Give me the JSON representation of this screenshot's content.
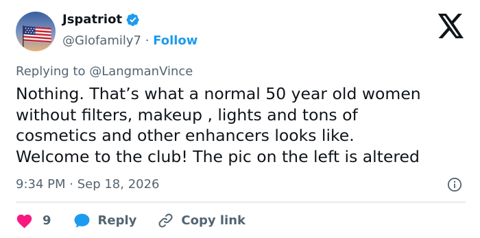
{
  "author": {
    "display_name": "Jspatriot",
    "handle": "@Glofamily7",
    "separator": " · ",
    "follow_label": "Follow",
    "verified": true,
    "avatar_icon": "us-flag-avatar"
  },
  "platform_logo": "x-logo-icon",
  "reply_context": {
    "prefix": "Replying to ",
    "handle": "@LangmanVince"
  },
  "tweet": {
    "text": "Nothing. That’s what a normal 50 year old women\nwithout filters, makeup , lights and tons of\ncosmetics  and other enhancers looks like.\nWelcome to the club!  The pic on the left is altered",
    "timestamp": "9:34 PM · Sep 18, 2026"
  },
  "actions": {
    "like_count": "9",
    "reply_label": "Reply",
    "copy_label": "Copy link"
  },
  "colors": {
    "accent": "#1d9bf0",
    "like": "#f91880",
    "muted": "#536471",
    "text": "#0f1419"
  }
}
